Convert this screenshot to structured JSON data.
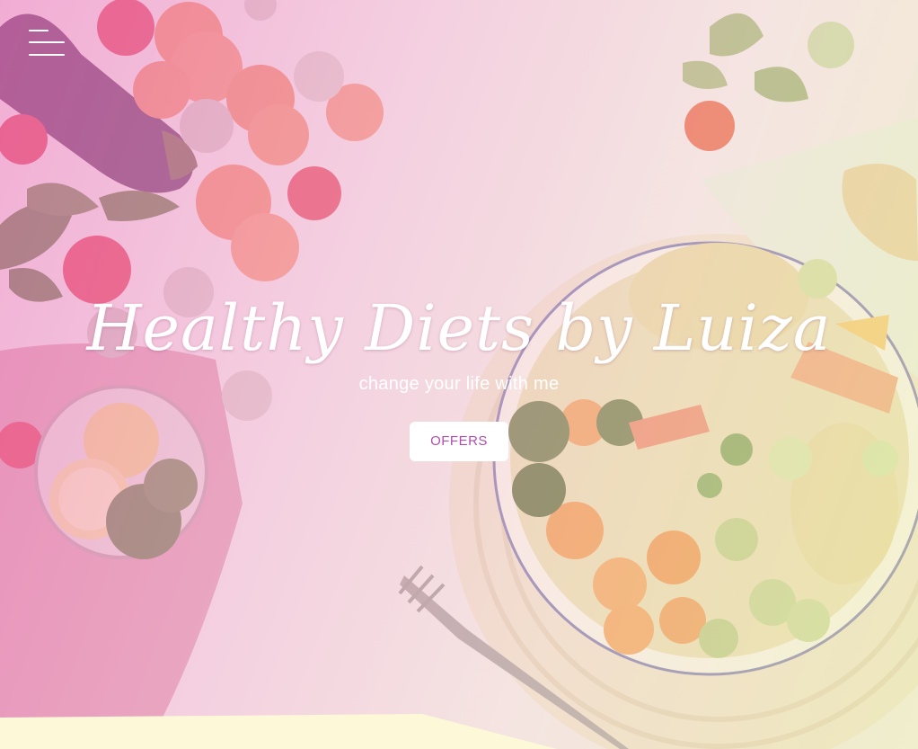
{
  "hero": {
    "title": "Healthy Diets by Luiza",
    "subtitle": "change your life with me",
    "offers_label": "OFFERS"
  },
  "nav": {
    "menu_icon": "hamburger-menu-icon"
  },
  "colors": {
    "button_text": "#b34db0",
    "button_bg": "#ffffff",
    "bottom_band": "#fdf8d8"
  }
}
